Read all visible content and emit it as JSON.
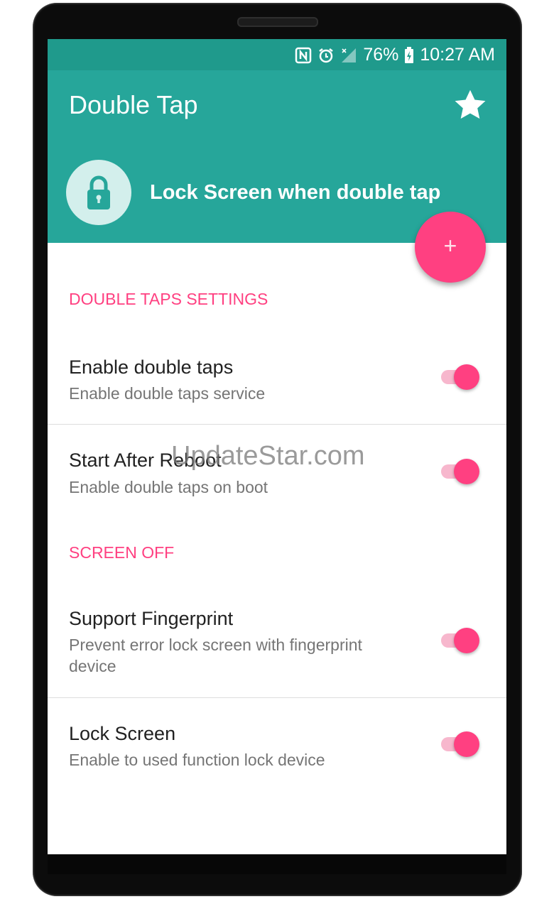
{
  "status_bar": {
    "battery": "76%",
    "time": "10:27 AM",
    "icons": [
      "nfc-icon",
      "alarm-icon",
      "signal-icon",
      "battery-charging-icon"
    ]
  },
  "app_bar": {
    "title": "Double Tap",
    "action_icon": "star-icon",
    "header_icon": "lock-icon",
    "header_text": "Lock Screen when double tap"
  },
  "fab": {
    "label": "+"
  },
  "sections": [
    {
      "title": "DOUBLE TAPS SETTINGS",
      "items": [
        {
          "title": "Enable double taps",
          "subtitle": "Enable double taps service",
          "enabled": true
        },
        {
          "title": "Start After Reboot",
          "subtitle": "Enable double taps on boot",
          "enabled": true
        }
      ]
    },
    {
      "title": "SCREEN OFF",
      "items": [
        {
          "title": "Support Fingerprint",
          "subtitle": "Prevent error lock screen with fingerprint device",
          "enabled": true
        },
        {
          "title": "Lock Screen",
          "subtitle": "Enable to used function lock device",
          "enabled": true
        }
      ]
    }
  ],
  "watermark": "UpdateStar.com",
  "colors": {
    "primary": "#26a69a",
    "primary_dark": "#1f9a8c",
    "accent": "#ff4081"
  }
}
